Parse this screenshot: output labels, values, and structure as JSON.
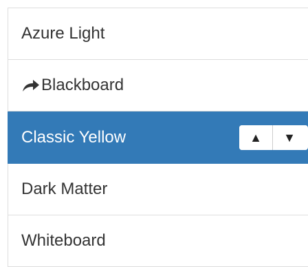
{
  "themes": {
    "items": [
      {
        "label": "Azure Light"
      },
      {
        "label": "Blackboard",
        "icon": "share-arrow-icon"
      },
      {
        "label": "Classic Yellow",
        "selected": true
      },
      {
        "label": "Dark Matter"
      },
      {
        "label": "Whiteboard"
      }
    ],
    "move_up_symbol": "▲",
    "move_down_symbol": "▼"
  },
  "colors": {
    "selected_background": "#337ab7",
    "selected_text": "#ffffff",
    "text": "#333333",
    "border": "#dddddd"
  }
}
